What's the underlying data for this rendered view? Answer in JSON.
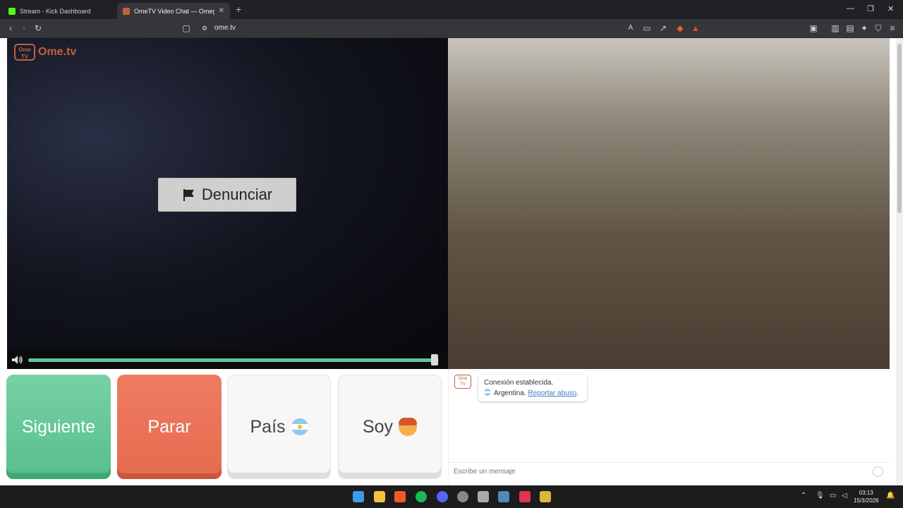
{
  "browser": {
    "tabs": [
      {
        "title": "Stream - Kick Dashboard",
        "active": false
      },
      {
        "title": "OmeTV Video Chat — Omeg",
        "active": true
      }
    ],
    "url": "ome.tv"
  },
  "site": {
    "logo_box": "Ome TV",
    "logo_text": "Ome.tv",
    "report_label": "Denunciar",
    "volume_level": 0.99
  },
  "controls": {
    "next_label": "Siguiente",
    "stop_label": "Parar",
    "country_label": "País",
    "gender_label": "Soy"
  },
  "chat": {
    "logo": "Ome TV",
    "status": "Conexión establecida.",
    "country": "Argentina.",
    "report_link": "Reportar abuso",
    "report_suffix": ".",
    "input_placeholder": "Escribe un mensaje"
  },
  "taskbar": {
    "time": "03:13",
    "date": "15/3/2026"
  },
  "colors": {
    "next": "#5cc08f",
    "stop": "#e66c50",
    "brand": "#c0623f",
    "volume": "#65c49a"
  }
}
